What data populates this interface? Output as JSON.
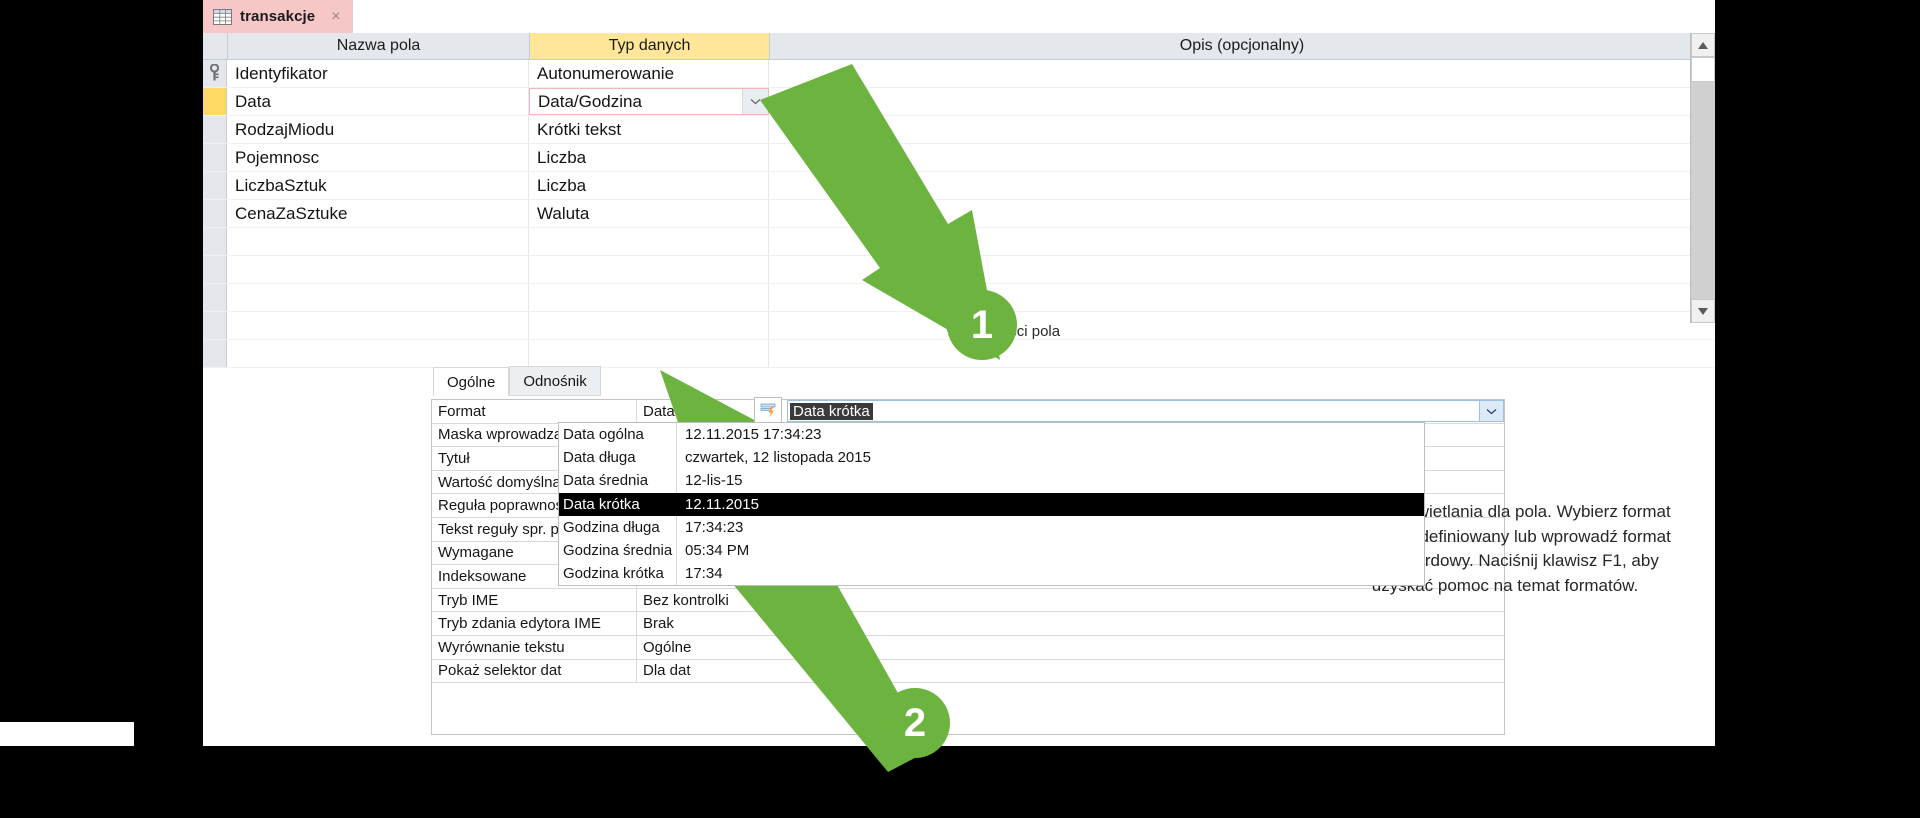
{
  "app": {
    "tab": {
      "label": "transakcje",
      "close_label": "×",
      "icon": "table-icon"
    }
  },
  "grid": {
    "headers": {
      "field_name": "Nazwa pola",
      "data_type": "Typ danych",
      "description": "Opis (opcjonalny)"
    },
    "rows": [
      {
        "name": "Identyfikator",
        "type": "Autonumerowanie",
        "desc": "",
        "primary_key": true,
        "selected": false
      },
      {
        "name": "Data",
        "type": "Data/Godzina",
        "desc": "",
        "primary_key": false,
        "selected": true
      },
      {
        "name": "RodzajMiodu",
        "type": "Krótki tekst",
        "desc": "",
        "primary_key": false,
        "selected": false
      },
      {
        "name": "Pojemnosc",
        "type": "Liczba",
        "desc": "",
        "primary_key": false,
        "selected": false
      },
      {
        "name": "LiczbaSztuk",
        "type": "Liczba",
        "desc": "",
        "primary_key": false,
        "selected": false
      },
      {
        "name": "CenaZaSztuke",
        "type": "Waluta",
        "desc": "",
        "primary_key": false,
        "selected": false
      }
    ],
    "empty_row_count": 5
  },
  "properties": {
    "section_title": "Właściwości pola",
    "tabs": [
      {
        "label": "Ogólne",
        "active": true
      },
      {
        "label": "Odnośnik",
        "active": false
      }
    ],
    "rows": [
      {
        "label": "Format",
        "value": "Data krótka",
        "editing": true
      },
      {
        "label": "Maska wprowadzania",
        "value": ""
      },
      {
        "label": "Tytuł",
        "value": ""
      },
      {
        "label": "Wartość domyślna",
        "value": ""
      },
      {
        "label": "Reguła poprawności",
        "value": ""
      },
      {
        "label": "Tekst reguły spr. poprawności",
        "value": ""
      },
      {
        "label": "Wymagane",
        "value": ""
      },
      {
        "label": "Indeksowane",
        "value": ""
      },
      {
        "label": "Tryb IME",
        "value": "Bez kontrolki"
      },
      {
        "label": "Tryb zdania edytora IME",
        "value": "Brak"
      },
      {
        "label": "Wyrównanie tekstu",
        "value": "Ogólne"
      },
      {
        "label": "Pokaż selektor dat",
        "value": "Dla dat"
      }
    ]
  },
  "format_dropdown": {
    "selected": "Data krótka",
    "options": [
      {
        "name": "Data ogólna",
        "sample": "12.11.2015 17:34:23",
        "highlighted": false
      },
      {
        "name": "Data długa",
        "sample": "czwartek, 12 listopada 2015",
        "highlighted": false
      },
      {
        "name": "Data średnia",
        "sample": "12-lis-15",
        "highlighted": false
      },
      {
        "name": "Data krótka",
        "sample": "12.11.2015",
        "highlighted": true
      },
      {
        "name": "Godzina długa",
        "sample": "17:34:23",
        "highlighted": false
      },
      {
        "name": "Godzina średnia",
        "sample": "05:34 PM",
        "highlighted": false
      },
      {
        "name": "Godzina krótka",
        "sample": "17:34",
        "highlighted": false
      }
    ]
  },
  "help": {
    "text": "Układ wyświetlania dla pola. Wybierz format wstępnie zdefiniowany lub wprowadź format niestandardowy. Naciśnij klawisz F1, aby uzyskać pomoc na temat formatów."
  },
  "annotations": [
    {
      "id": "1",
      "label": "1",
      "target": "data-type-combo-dropdown-button",
      "color": "#6cb33f"
    },
    {
      "id": "2",
      "label": "2",
      "target": "format-dropdown-highlighted-option",
      "color": "#6cb33f"
    }
  ],
  "colors": {
    "tab_background": "#f7c6c6",
    "header_highlight": "#ffe699",
    "row_selector_active": "#ffd966",
    "annotation_green": "#6cb33f",
    "selection_black": "#000000"
  }
}
